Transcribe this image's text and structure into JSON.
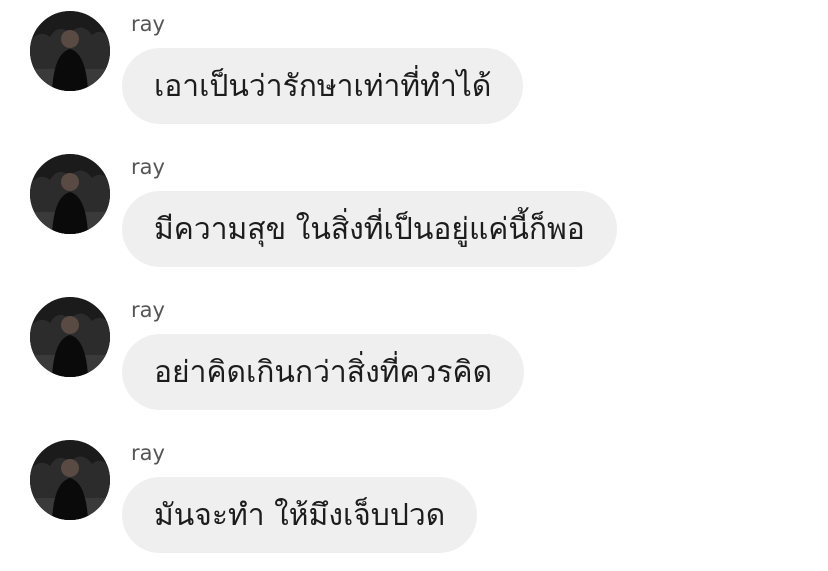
{
  "messages": [
    {
      "sender": "ray",
      "text": "เอาเป็นว่ารักษาเท่าที่ทำได้"
    },
    {
      "sender": "ray",
      "text": "มีความสุข ในสิ่งที่เป็นอยู่แค่นี้ก็พอ"
    },
    {
      "sender": "ray",
      "text": "อย่าคิดเกินกว่าสิ่งที่ควรคิด"
    },
    {
      "sender": "ray",
      "text": "มันจะทำ ให้มึงเจ็บปวด"
    }
  ]
}
